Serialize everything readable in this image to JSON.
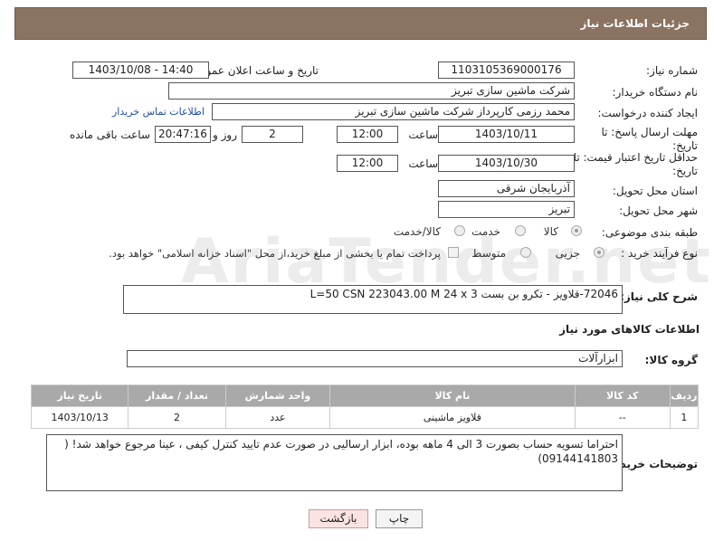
{
  "header": {
    "title": "جزئیات اطلاعات نیاز"
  },
  "fields": {
    "need_number_label": "شماره نیاز:",
    "need_number": "1103105369000176",
    "announce_label": "تاریخ و ساعت اعلان عمومی:",
    "announce_value": "1403/10/08 - 14:40",
    "buyer_label": "نام دستگاه خریدار:",
    "buyer_value": "شرکت ماشین سازی تبریز",
    "creator_label": "ایجاد کننده درخواست:",
    "creator_value": "محمد رزمی کارپرداز شرکت ماشین سازی تبریز",
    "contact_link": "اطلاعات تماس خریدار",
    "deadline_label": "مهلت ارسال پاسخ: تا تاریخ:",
    "deadline_date": "1403/10/11",
    "hour_label": "ساعت",
    "deadline_time": "12:00",
    "days_value": "2",
    "days_label": "روز و",
    "remaining_time": "20:47:16",
    "remaining_label": "ساعت باقی مانده",
    "validity_label": "حداقل تاریخ اعتبار قیمت: تا تاریخ:",
    "validity_date": "1403/10/30",
    "validity_time": "12:00",
    "province_label": "استان محل تحویل:",
    "province_value": "آذربایجان شرقی",
    "city_label": "شهر محل تحویل:",
    "city_value": "تبریز",
    "category_label": "طبقه بندی موضوعی:",
    "category_options": [
      "کالا",
      "خدمت",
      "کالا/خدمت"
    ],
    "process_label": "نوع فرآیند خرید :",
    "process_options": [
      "جزیی",
      "متوسط"
    ],
    "payment_note": "پرداخت تمام یا بخشی از مبلغ خرید،از محل \"اسناد خزانه اسلامی\" خواهد بود."
  },
  "description": {
    "label": "شرح کلی نیاز:",
    "value": "72046-قلاویز - تکرو بن بست     L=50 CSN 223043.00     M 24 x 3"
  },
  "goods": {
    "section_title": "اطلاعات کالاهای مورد نیاز",
    "group_label": "گروه کالا:",
    "group_value": "ابزارآلات",
    "columns": [
      "ردیف",
      "کد کالا",
      "نام کالا",
      "واحد شمارش",
      "تعداد / مقدار",
      "تاریخ نیاز"
    ],
    "rows": [
      {
        "row": "1",
        "code": "--",
        "name": "قلاویز ماشینی",
        "unit": "عدد",
        "qty": "2",
        "date": "1403/10/13"
      }
    ]
  },
  "buyer_notes": {
    "label": "توضیحات خریدار:",
    "value": "احتراما تسویه حساب بصورت 3 الی 4 ماهه بوده، ابزار ارسالیی در صورت عدم تایید کنترل کیفی ، عینا مرجوع خواهد شد! ( 09144141803)"
  },
  "buttons": {
    "print": "چاپ",
    "back": "بازگشت"
  },
  "watermark": "AriaTender.net"
}
